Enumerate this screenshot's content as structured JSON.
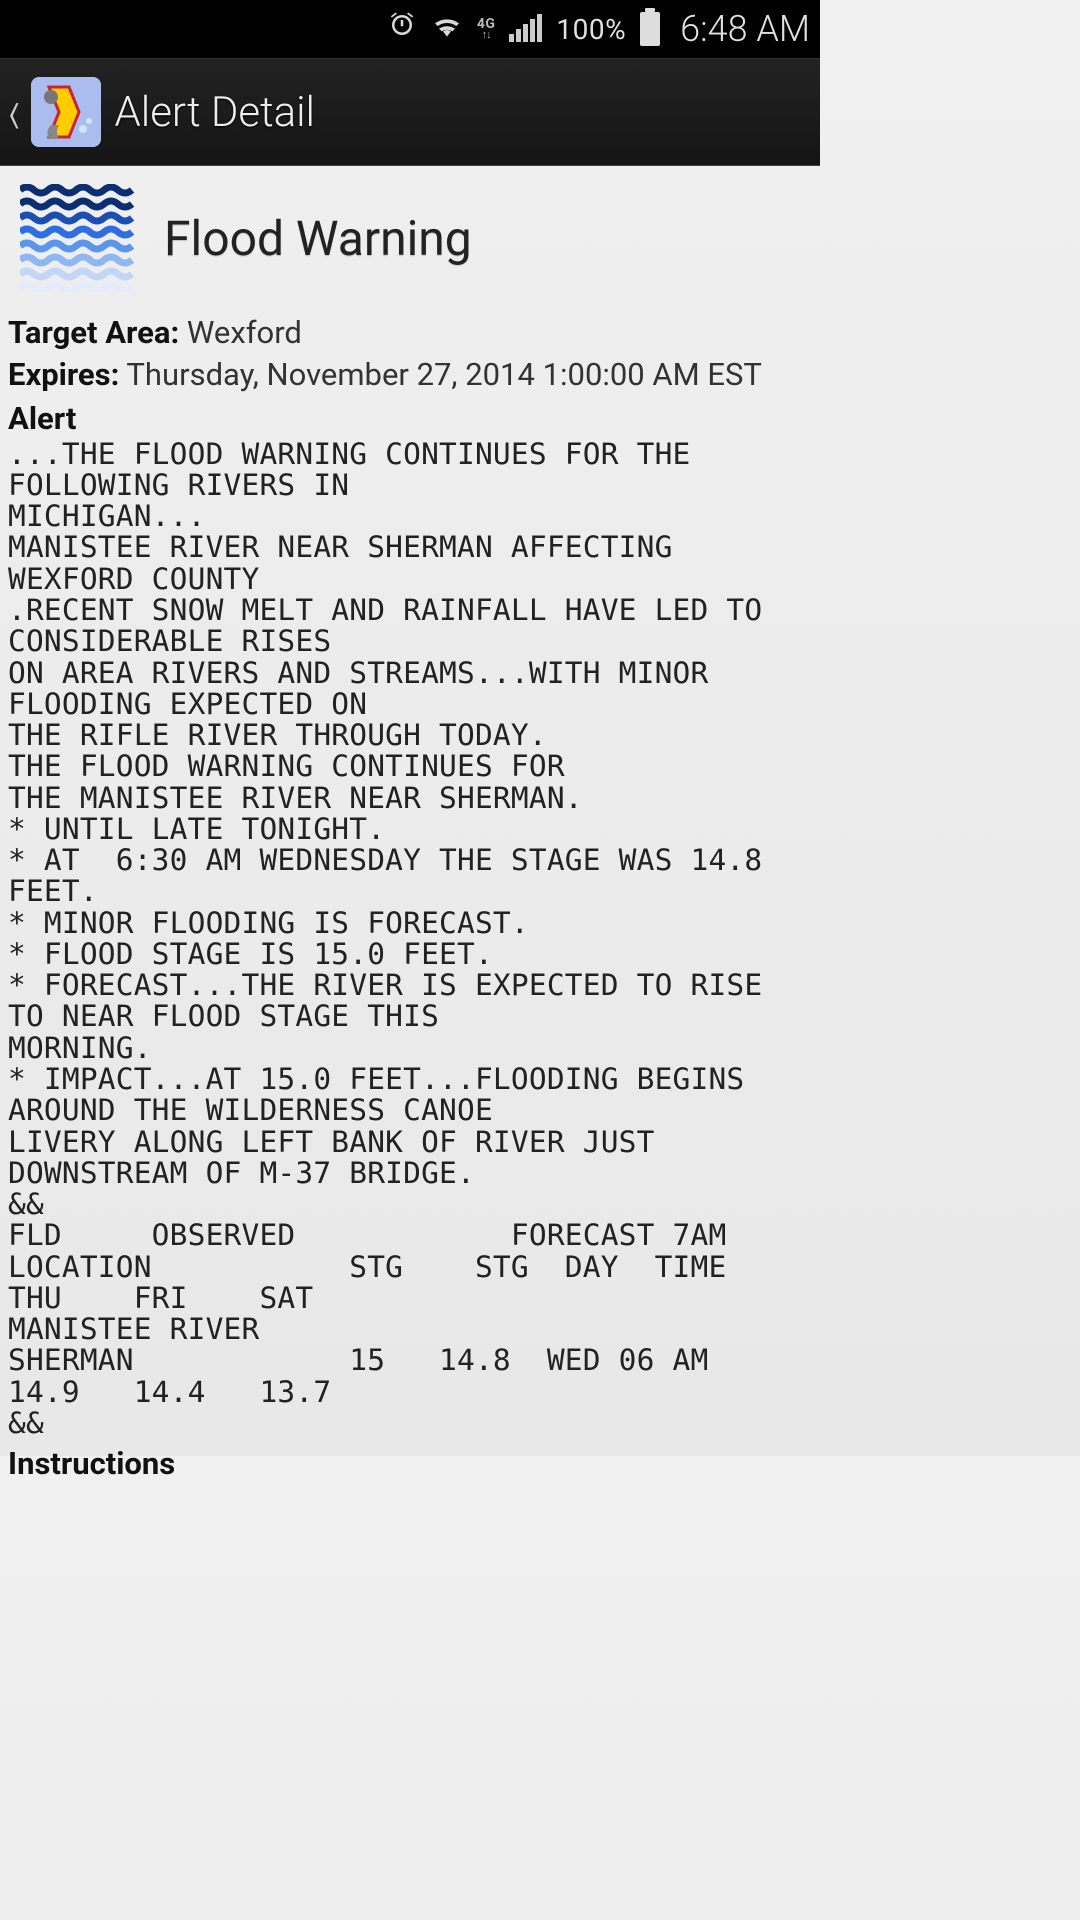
{
  "statusbar": {
    "network_label": "4G LTE",
    "battery_pct": "100%",
    "time": "6:48 AM"
  },
  "actionbar": {
    "title": "Alert Detail"
  },
  "alert": {
    "type_title": "Flood Warning",
    "target_area_label": "Target Area:",
    "target_area_value": " Wexford",
    "expires_label": "Expires:",
    "expires_value": " Thursday, November 27, 2014 1:00:00 AM EST",
    "alert_heading": "Alert",
    "body": "...THE FLOOD WARNING CONTINUES FOR THE FOLLOWING RIVERS IN\nMICHIGAN...\nMANISTEE RIVER NEAR SHERMAN AFFECTING WEXFORD COUNTY\n.RECENT SNOW MELT AND RAINFALL HAVE LED TO CONSIDERABLE RISES\nON AREA RIVERS AND STREAMS...WITH MINOR FLOODING EXPECTED ON\nTHE RIFLE RIVER THROUGH TODAY.\nTHE FLOOD WARNING CONTINUES FOR\nTHE MANISTEE RIVER NEAR SHERMAN.\n* UNTIL LATE TONIGHT.\n* AT  6:30 AM WEDNESDAY THE STAGE WAS 14.8 FEET.\n* MINOR FLOODING IS FORECAST.\n* FLOOD STAGE IS 15.0 FEET.\n* FORECAST...THE RIVER IS EXPECTED TO RISE TO NEAR FLOOD STAGE THIS\nMORNING.\n* IMPACT...AT 15.0 FEET...FLOODING BEGINS AROUND THE WILDERNESS CANOE\nLIVERY ALONG LEFT BANK OF RIVER JUST DOWNSTREAM OF M-37 BRIDGE.\n&&\nFLD     OBSERVED            FORECAST 7AM\nLOCATION           STG    STG  DAY  TIME\nTHU    FRI    SAT\nMANISTEE RIVER\nSHERMAN            15   14.8  WED 06 AM     14.9   14.4   13.7\n&&",
    "instructions_heading": "Instructions"
  }
}
